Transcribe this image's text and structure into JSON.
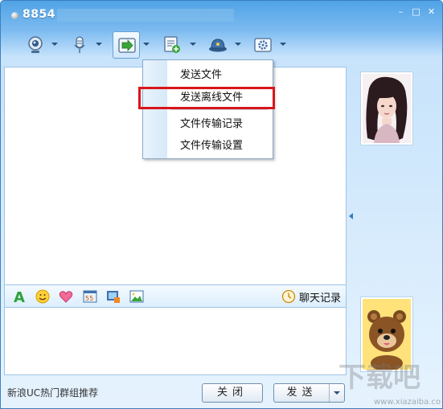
{
  "window": {
    "title": "8854"
  },
  "window_controls": {
    "minimize": "–",
    "maximize": "□",
    "close": "✕"
  },
  "toolbar": {
    "items": [
      "video-call",
      "voice-call",
      "file-transfer",
      "add-app",
      "ucstar",
      "settings"
    ],
    "active": "file-transfer"
  },
  "file_menu": {
    "items": [
      {
        "label": "发送文件"
      },
      {
        "label": "发送离线文件",
        "highlighted": true
      },
      {
        "label": "文件传输记录"
      },
      {
        "label": "文件传输设置"
      }
    ]
  },
  "input_toolbar": {
    "history_label": "聊天记录"
  },
  "bottom": {
    "recommend": "新浪UC热门群组推荐",
    "close_label": "关闭",
    "send_label": "发送"
  },
  "watermark": {
    "text": "下载吧",
    "url": "www.xiazaiba.com"
  },
  "colors": {
    "title_gradient_top": "#4fa3e6",
    "highlight": "#d8161b",
    "menu_border": "#8aa9c8"
  }
}
